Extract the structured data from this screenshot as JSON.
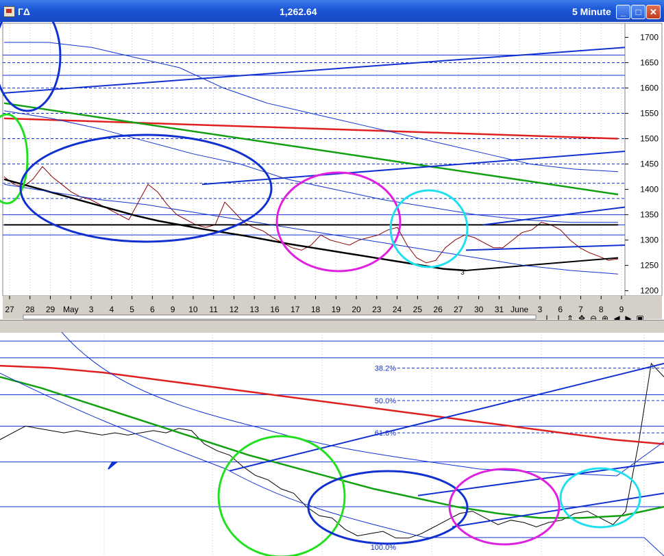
{
  "window": {
    "symbol": "ГΔ",
    "price": "1,262.64",
    "interval": "5 Minute",
    "buttons": [
      "minimize",
      "maximize",
      "close"
    ]
  },
  "colors": {
    "bg": "#ffffff",
    "titlebar": "#1b55d6",
    "blue": "#1030d0",
    "red": "#e02020",
    "green": "#10a010",
    "magenta": "#e020e0",
    "cyan": "#20e0f0",
    "lightgreen": "#20e020"
  },
  "toolbar_icons": [
    "text-I",
    "bar-I",
    "move-vertical",
    "move-all",
    "zoom-out",
    "zoom-in",
    "scroll-left",
    "scroll-right",
    "save"
  ],
  "chart_data": [
    {
      "type": "line",
      "title": "",
      "y_ticks": [
        1200,
        1250,
        1300,
        1350,
        1400,
        1450,
        1500,
        1550,
        1600,
        1650,
        1700
      ],
      "ylim": [
        1190,
        1725
      ],
      "x_ticks": [
        "27",
        "28",
        "29",
        "May",
        "3",
        "4",
        "5",
        "6",
        "9",
        "10",
        "11",
        "12",
        "13",
        "16",
        "17",
        "18",
        "19",
        "20",
        "23",
        "24",
        "25",
        "26",
        "27",
        "30",
        "31",
        "June",
        "3",
        "6",
        "7",
        "8",
        "9"
      ],
      "annotations": [
        "3"
      ],
      "series": [
        {
          "values": [
            1425,
            1410,
            1405,
            1420,
            1445,
            1425,
            1410,
            1395,
            1385,
            1380,
            1370,
            1360,
            1350,
            1340,
            1375,
            1410,
            1395,
            1370,
            1350,
            1340,
            1330,
            1325,
            1330,
            1375,
            1355,
            1335,
            1325,
            1318,
            1305,
            1295,
            1285,
            1280,
            1290,
            1310,
            1300,
            1295,
            1290,
            1300,
            1305,
            1310,
            1320,
            1325,
            1290,
            1265,
            1255,
            1260,
            1285,
            1300,
            1310,
            1305,
            1295,
            1285,
            1285,
            1300,
            1315,
            1320,
            1335,
            1330,
            1320,
            1300,
            1285,
            1275,
            1268,
            1260,
            1263
          ]
        },
        {
          "values": [
            1420,
            1408,
            1396,
            1384,
            1372,
            1360,
            1348,
            1338,
            1330,
            1322,
            1315,
            1308,
            1300,
            1292,
            1285,
            1278,
            1271,
            1264,
            1257,
            1250,
            1243,
            1240
          ]
        },
        {
          "values": [
            1330,
            1330
          ]
        },
        {
          "values": [
            1540,
            1500
          ]
        },
        {
          "values": [
            1570,
            1390
          ]
        },
        {
          "values": [
            1590,
            1680
          ]
        },
        {
          "values": [
            1410,
            1475
          ]
        },
        {
          "values": [
            1240,
            1265
          ]
        },
        {
          "values": [
            1330,
            1365
          ]
        },
        {
          "values": [
            1280,
            1290
          ]
        },
        {
          "values": [
            1690,
            1690,
            1680,
            1660,
            1640,
            1600,
            1570,
            1550,
            1530,
            1510,
            1490,
            1470,
            1450,
            1440,
            1435
          ]
        },
        {
          "values": [
            1555,
            1540,
            1520,
            1495,
            1470,
            1450,
            1420,
            1400,
            1380,
            1365,
            1350,
            1340,
            1335,
            1335
          ]
        },
        {
          "values": [
            1410,
            1395,
            1380,
            1370,
            1355,
            1340,
            1325,
            1310,
            1295,
            1280,
            1265,
            1250,
            1240,
            1233
          ]
        }
      ],
      "h_levels_solid": [
        1665,
        1625,
        1350,
        1330,
        1310
      ],
      "h_levels_dashed": [
        1650,
        1600,
        1550,
        1500,
        1450,
        1412,
        1382
      ],
      "ellipses": [
        "blue",
        "green",
        "blue",
        "magenta",
        "cyan"
      ]
    },
    {
      "type": "line",
      "title": "",
      "annotations": [
        "38.2%",
        "50.0%",
        "61.8%",
        "100.0%"
      ],
      "series": [
        {
          "values": [
            0.52,
            0.55,
            0.58,
            0.57,
            0.56,
            0.55,
            0.56,
            0.55,
            0.54,
            0.55,
            0.54,
            0.55,
            0.56,
            0.55,
            0.57,
            0.56,
            0.5,
            0.47,
            0.45,
            0.4,
            0.36,
            0.34,
            0.3,
            0.28,
            0.22,
            0.18,
            0.17,
            0.12,
            0.09,
            0.1,
            0.11,
            0.08,
            0.08,
            0.1,
            0.13,
            0.16,
            0.19,
            0.2,
            0.17,
            0.14,
            0.16,
            0.15,
            0.13,
            0.15,
            0.16,
            0.19,
            0.2,
            0.17,
            0.14,
            0.2,
            0.5,
            0.86,
            0.8
          ]
        },
        {
          "values": [
            0.85,
            0.84,
            0.82,
            0.79,
            0.76,
            0.73,
            0.7,
            0.67,
            0.64,
            0.61,
            0.58,
            0.55,
            0.52,
            0.5
          ]
        },
        {
          "values": [
            0.8,
            0.75,
            0.69,
            0.63,
            0.57,
            0.51,
            0.45,
            0.4,
            0.35,
            0.3,
            0.26,
            0.22,
            0.19,
            0.17,
            0.17,
            0.18,
            0.22
          ]
        },
        {
          "values": [
            0.38,
            0.86
          ]
        },
        {
          "values": [
            0.27,
            0.42
          ]
        },
        {
          "values": [
            0.13,
            0.28
          ]
        }
      ],
      "ellipses": [
        "green",
        "blue",
        "magenta",
        "cyan"
      ]
    }
  ]
}
